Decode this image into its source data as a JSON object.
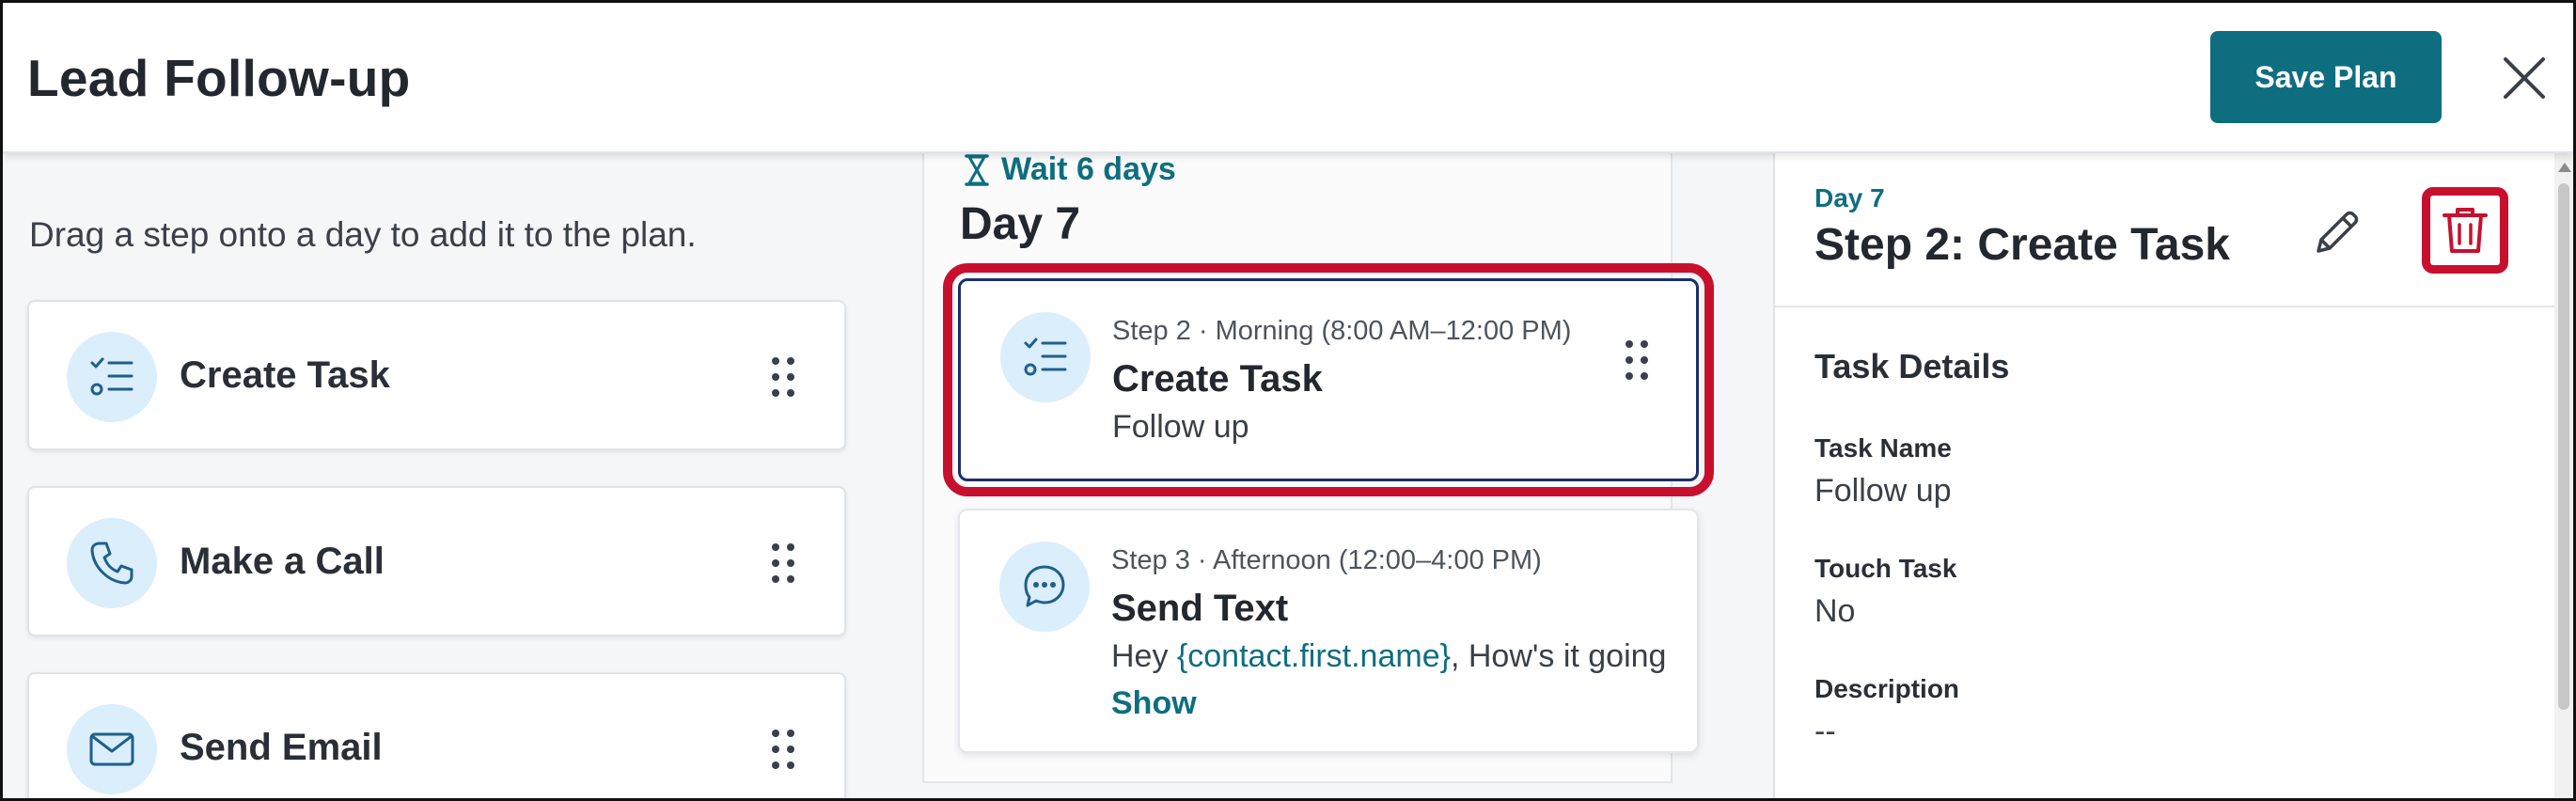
{
  "header": {
    "title": "Lead Follow-up",
    "save_label": "Save Plan",
    "close_icon": "close-icon"
  },
  "left_panel": {
    "hint": "Drag a step onto a day to add it to the plan.",
    "steps": [
      {
        "label": "Create Task",
        "icon": "task-list-icon"
      },
      {
        "label": "Make a Call",
        "icon": "phone-icon"
      },
      {
        "label": "Send Email",
        "icon": "envelope-icon"
      }
    ]
  },
  "timeline": {
    "wait_label": "Wait 6 days",
    "day_heading": "Day 7",
    "cards": [
      {
        "meta": "Step 2 · Morning (8:00 AM–12:00 PM)",
        "title": "Create Task",
        "subtitle": "Follow up",
        "selected": true
      },
      {
        "meta": "Step 3 · Afternoon (12:00–4:00 PM)",
        "title": "Send Text",
        "body_prefix": "Hey ",
        "body_token": "{contact.first.name}",
        "body_suffix": ", How's it going",
        "show_label": "Show",
        "selected": false
      }
    ]
  },
  "details": {
    "day": "Day 7",
    "title": "Step 2: Create Task",
    "section_title": "Task Details",
    "fields": [
      {
        "label": "Task Name",
        "value": "Follow up"
      },
      {
        "label": "Touch Task",
        "value": "No"
      },
      {
        "label": "Description",
        "value": "--"
      }
    ]
  },
  "colors": {
    "accent": "#0e6e80",
    "highlight": "#c8102e",
    "icon_bg": "#dbeefb"
  }
}
